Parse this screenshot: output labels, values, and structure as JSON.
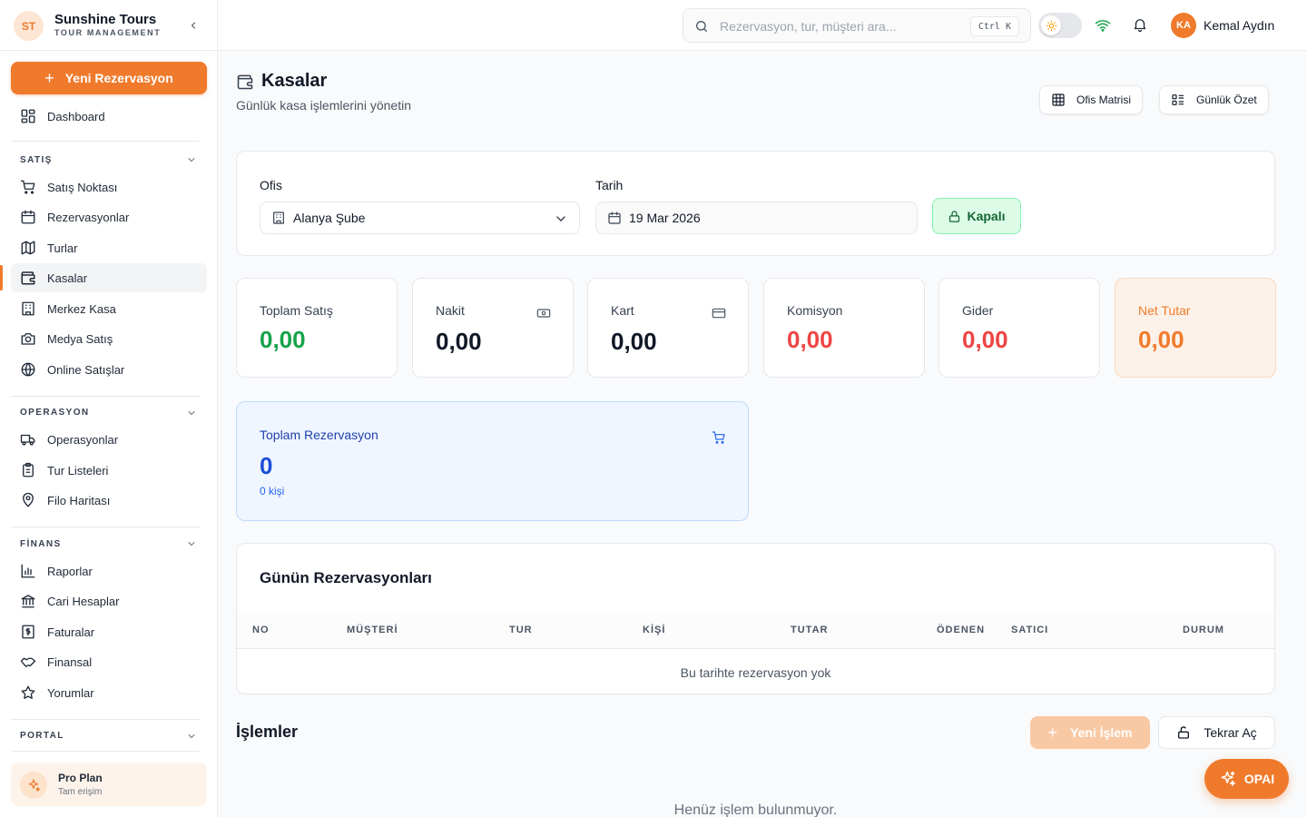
{
  "brand": {
    "initials": "ST",
    "name": "Sunshine Tours",
    "subtitle": "TOUR MANAGEMENT"
  },
  "sidebar": {
    "new_reservation": "Yeni Rezervasyon",
    "dashboard": "Dashboard",
    "sections": [
      {
        "label": "SATIŞ",
        "items": [
          "Satış Noktası",
          "Rezervasyonlar",
          "Turlar",
          "Kasalar",
          "Merkez Kasa",
          "Medya Satış",
          "Online Satışlar"
        ]
      },
      {
        "label": "OPERASYON",
        "items": [
          "Operasyonlar",
          "Tur Listeleri",
          "Filo Haritası"
        ]
      },
      {
        "label": "FİNANS",
        "items": [
          "Raporlar",
          "Cari Hesaplar",
          "Faturalar",
          "Finansal",
          "Yorumlar"
        ]
      },
      {
        "label": "PORTAL",
        "items": []
      }
    ],
    "active_item": "Kasalar",
    "pro_plan": {
      "title": "Pro Plan",
      "subtitle": "Tam erişim"
    }
  },
  "topbar": {
    "search_placeholder": "Rezervasyon, tur, müşteri ara...",
    "shortcut_ctrl": "Ctrl",
    "shortcut_key": "K",
    "user_initials": "KA",
    "user_name": "Kemal Aydın"
  },
  "page": {
    "title": "Kasalar",
    "subtitle": "Günlük kasa işlemlerini yönetin",
    "buttons": {
      "office_matrix": "Ofis Matrisi",
      "daily_summary": "Günlük Özet"
    }
  },
  "filters": {
    "office_label": "Ofis",
    "office_value": "Alanya Şube",
    "date_label": "Tarih",
    "date_value": "19 Mar 2026",
    "status_button": "Kapalı"
  },
  "stats": [
    {
      "label": "Toplam Satış",
      "value": "0,00",
      "color": "#16a34a"
    },
    {
      "label": "Nakit",
      "value": "0,00",
      "color": "#111827",
      "icon": "cash-icon"
    },
    {
      "label": "Kart",
      "value": "0,00",
      "color": "#111827",
      "icon": "card-icon"
    },
    {
      "label": "Komisyon",
      "value": "0,00",
      "color": "#ef4444"
    },
    {
      "label": "Gider",
      "value": "0,00",
      "color": "#ef4444"
    },
    {
      "label": "Net Tutar",
      "value": "0,00",
      "color": "#f07a2c"
    }
  ],
  "total_reservations": {
    "label": "Toplam Rezervasyon",
    "value": "0",
    "people": "0 kişi"
  },
  "reservations_table": {
    "title": "Günün Rezervasyonları",
    "columns": [
      "NO",
      "MÜŞTERİ",
      "TUR",
      "KİŞİ",
      "TUTAR",
      "ÖDENEN",
      "SATICI",
      "DURUM"
    ],
    "rows": [],
    "empty_text": "Bu tarihte rezervasyon yok"
  },
  "operations": {
    "title": "İşlemler",
    "new_button": "Yeni İşlem",
    "reopen_button": "Tekrar Aç",
    "empty_text": "Henüz işlem bulunmuyor."
  },
  "assistant": {
    "label": "OPAI"
  },
  "colors": {
    "accent": "#f07a2c",
    "success": "#16a34a",
    "danger": "#ef4444",
    "info": "#1d4ed8"
  }
}
